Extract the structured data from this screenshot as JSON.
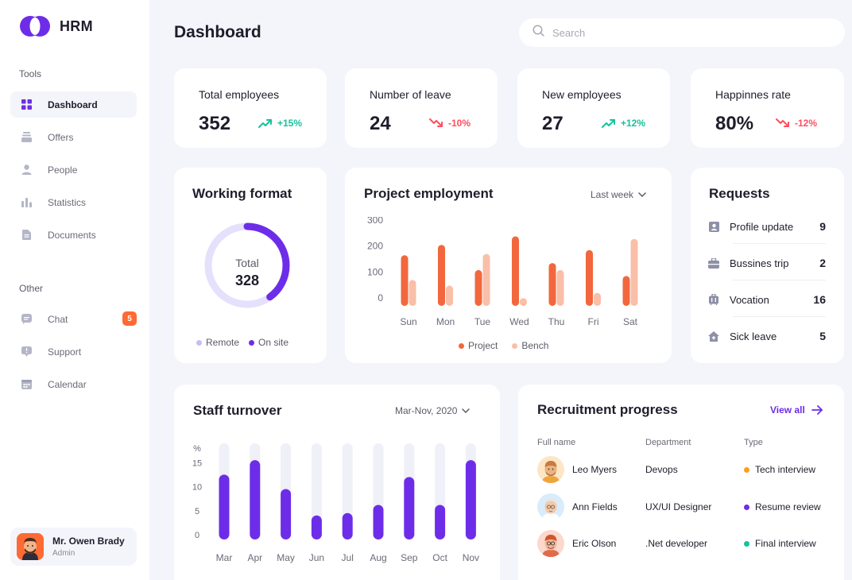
{
  "app": {
    "name": "HRM"
  },
  "sidebar": {
    "tools_label": "Tools",
    "other_label": "Other",
    "items": [
      {
        "label": "Dashboard",
        "icon": "grid-icon"
      },
      {
        "label": "Offers",
        "icon": "layers-icon"
      },
      {
        "label": "People",
        "icon": "user-icon"
      },
      {
        "label": "Statistics",
        "icon": "bar-chart-icon"
      },
      {
        "label": "Documents",
        "icon": "document-icon"
      }
    ],
    "other_items": [
      {
        "label": "Chat",
        "icon": "chat-icon",
        "badge": "5"
      },
      {
        "label": "Support",
        "icon": "support-icon"
      },
      {
        "label": "Calendar",
        "icon": "calendar-icon"
      }
    ],
    "user": {
      "name": "Mr. Owen Brady",
      "role": "Admin"
    }
  },
  "header": {
    "title": "Dashboard",
    "search_placeholder": "Search"
  },
  "kpis": [
    {
      "label": "Total employees",
      "value": "352",
      "delta": "+15%",
      "trend": "up"
    },
    {
      "label": "Number of leave",
      "value": "24",
      "delta": "-10%",
      "trend": "down"
    },
    {
      "label": "New employees",
      "value": "27",
      "delta": "+12%",
      "trend": "up"
    },
    {
      "label": "Happinnes rate",
      "value": "80%",
      "delta": "-12%",
      "trend": "down"
    }
  ],
  "working_format": {
    "title": "Working format",
    "center_label": "Total",
    "total": "328",
    "legend": [
      "Remote",
      "On site"
    ],
    "on_site_fraction": 0.4,
    "colors": {
      "remote": "#e5e0fb",
      "on_site": "#6d2de8"
    }
  },
  "project_employment": {
    "title": "Project employment",
    "period": "Last week",
    "legend": [
      "Project",
      "Bench"
    ],
    "colors": {
      "project": "#f2673d",
      "bench": "#f9bfa8"
    }
  },
  "requests": {
    "title": "Requests",
    "items": [
      {
        "label": "Profile update",
        "count": "9",
        "icon": "id-card-icon"
      },
      {
        "label": "Bussines trip",
        "count": "2",
        "icon": "briefcase-icon"
      },
      {
        "label": "Vocation",
        "count": "16",
        "icon": "luggage-icon"
      },
      {
        "label": "Sick leave",
        "count": "5",
        "icon": "home-icon"
      }
    ]
  },
  "staff_turnover": {
    "title": "Staff turnover",
    "period": "Mar-Nov, 2020",
    "colors": {
      "bar": "#6d2de8",
      "track": "#eff0f8"
    }
  },
  "recruitment": {
    "title": "Recruitment progress",
    "view_all": "View all",
    "columns": [
      "Full name",
      "Department",
      "Type"
    ],
    "rows": [
      {
        "name": "Leo Myers",
        "department": "Devops",
        "type": "Tech interview",
        "type_color": "#ff9e1b",
        "avatar_bg": "#fde6c6"
      },
      {
        "name": "Ann Fields",
        "department": "UX/UI Designer",
        "type": "Resume review",
        "type_color": "#6d2de8",
        "avatar_bg": "#d9ecfb"
      },
      {
        "name": "Eric Olson",
        "department": ".Net developer",
        "type": "Final interview",
        "type_color": "#13c39c",
        "avatar_bg": "#fbd9cc"
      }
    ]
  },
  "chart_data": [
    {
      "type": "bar",
      "title": "Project employment",
      "categories": [
        "Sun",
        "Mon",
        "Tue",
        "Wed",
        "Thu",
        "Fri",
        "Sat"
      ],
      "series": [
        {
          "name": "Project",
          "values": [
            195,
            235,
            138,
            268,
            165,
            215,
            115
          ]
        },
        {
          "name": "Bench",
          "values": [
            100,
            78,
            200,
            30,
            138,
            50,
            258
          ]
        }
      ],
      "yticks": [
        0,
        100,
        200,
        300
      ],
      "ylim": [
        0,
        300
      ],
      "legend": "bottom"
    },
    {
      "type": "bar",
      "title": "Staff turnover",
      "categories": [
        "Mar",
        "Apr",
        "May",
        "Jun",
        "Jul",
        "Aug",
        "Sep",
        "Oct",
        "Nov"
      ],
      "values": [
        13.5,
        16.5,
        10.5,
        5,
        5.5,
        7.2,
        13,
        7.2,
        16.5
      ],
      "ylabel": "%",
      "yticks": [
        0,
        5,
        10,
        15
      ],
      "ylim": [
        0,
        20
      ]
    }
  ]
}
